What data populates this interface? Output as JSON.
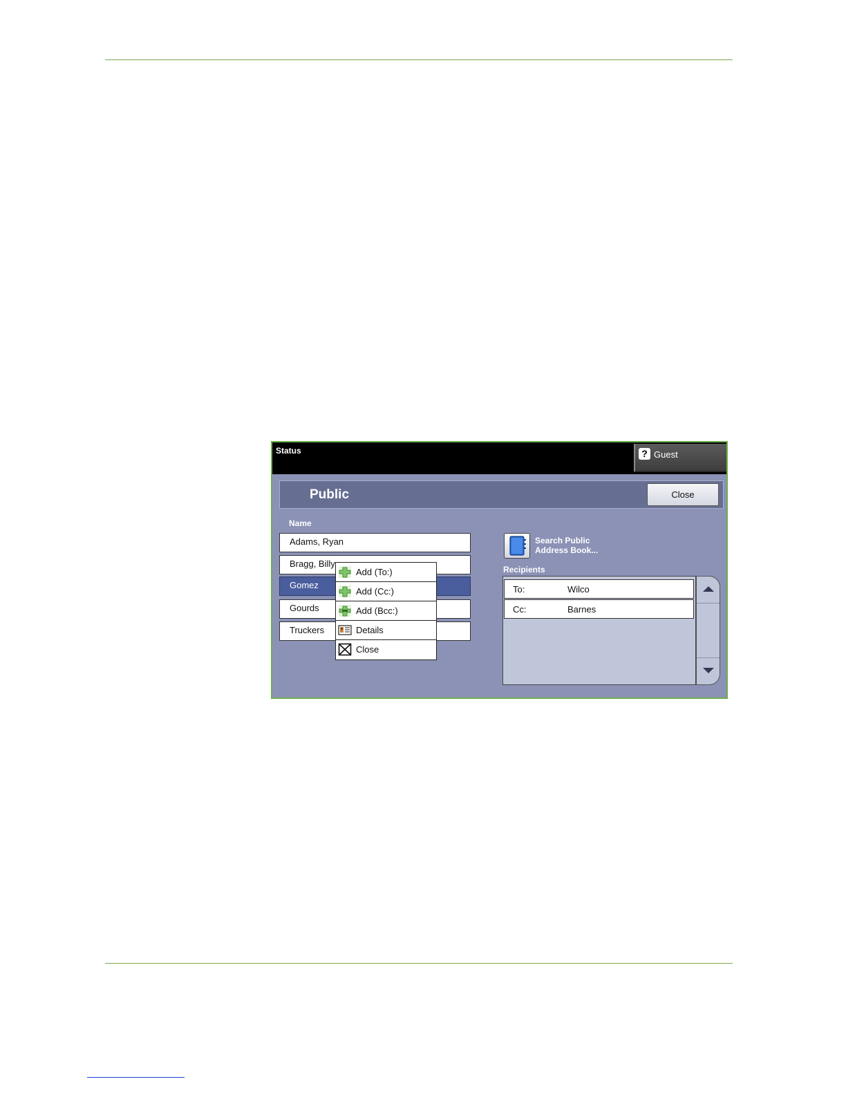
{
  "status_bar": {
    "label": "Status",
    "guest_label": "Guest",
    "help_glyph": "?"
  },
  "header": {
    "title": "Public",
    "close_label": "Close"
  },
  "name_list": {
    "label": "Name",
    "items": [
      "Adams, Ryan",
      "Bragg, Billy",
      "Gomez",
      "Gourds",
      "Truckers"
    ],
    "selected": "Gomez"
  },
  "context_menu": {
    "items": [
      {
        "label": "Add (To:)",
        "icon": "add-icon"
      },
      {
        "label": "Add (Cc:)",
        "icon": "add-icon"
      },
      {
        "label": "Add (Bcc:)",
        "icon": "add-icon"
      },
      {
        "label": "Details",
        "icon": "details-card-icon"
      },
      {
        "label": "Close",
        "icon": "close-box-icon"
      }
    ]
  },
  "search": {
    "label_line1": "Search Public",
    "label_line2": "Address Book..."
  },
  "recipients": {
    "label": "Recipients",
    "rows": [
      {
        "type": "To:",
        "name": "Wilco"
      },
      {
        "type": "Cc:",
        "name": "Barnes"
      }
    ]
  },
  "colors": {
    "panel_bg": "#8b92b5",
    "header_bg": "#666e92",
    "selected_row": "#4a5e9e",
    "frame_border": "#6db04a",
    "page_rule": "#7aa84a"
  }
}
